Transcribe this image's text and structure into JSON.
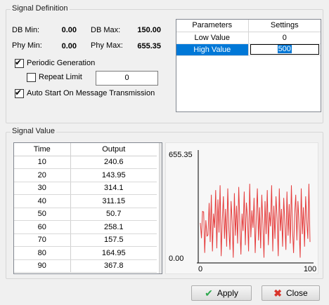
{
  "signal_definition": {
    "title": "Signal Definition",
    "db_min_label": "DB Min:",
    "db_min_value": "0.00",
    "db_max_label": "DB Max:",
    "db_max_value": "150.00",
    "phy_min_label": "Phy Min:",
    "phy_min_value": "0.00",
    "phy_max_label": "Phy Max:",
    "phy_max_value": "655.35",
    "periodic_generation": {
      "label": "Periodic Generation",
      "checked": true
    },
    "repeat_limit": {
      "label": "Repeat Limit",
      "checked": false,
      "value": "0"
    },
    "auto_start": {
      "label": "Auto Start On Message Transmission",
      "checked": true
    },
    "params_table": {
      "headers": [
        "Parameters",
        "Settings"
      ],
      "rows": [
        {
          "param": "Low Value",
          "setting": "0"
        },
        {
          "param": "High Value",
          "setting": "500"
        }
      ]
    }
  },
  "signal_value": {
    "title": "Signal Value",
    "list_headers": [
      "Time",
      "Output"
    ],
    "rows": [
      {
        "time": "10",
        "output": "240.6"
      },
      {
        "time": "20",
        "output": "143.95"
      },
      {
        "time": "30",
        "output": "314.1"
      },
      {
        "time": "40",
        "output": "311.15"
      },
      {
        "time": "50",
        "output": "50.7"
      },
      {
        "time": "60",
        "output": "258.1"
      },
      {
        "time": "70",
        "output": "157.5"
      },
      {
        "time": "80",
        "output": "164.95"
      },
      {
        "time": "90",
        "output": "367.8"
      }
    ]
  },
  "chart_data": {
    "type": "line",
    "y_max_label": "655.35",
    "y_min_label": "0.00",
    "x_tick_labels": [
      "0",
      "100"
    ],
    "xlim": [
      0,
      100
    ],
    "ylim": [
      0,
      655.35
    ],
    "line_color": "#e53b3b",
    "series": [
      {
        "values": [
          240.6,
          143.95,
          314.1,
          311.15,
          50.7,
          258.1,
          157.5,
          164.95,
          367.8,
          120,
          420,
          60,
          300,
          210,
          450,
          80,
          390,
          180,
          480,
          30,
          260,
          410,
          140,
          330,
          90,
          460,
          200,
          70,
          380,
          250,
          20,
          430,
          160,
          350,
          110,
          470,
          230,
          40,
          300,
          190,
          440,
          100,
          370,
          270,
          60,
          490,
          150,
          320,
          210,
          400,
          50,
          280,
          460,
          130,
          340,
          80,
          420,
          240,
          20,
          380,
          170,
          450,
          100,
          310,
          220,
          480,
          60,
          350,
          140,
          410,
          270,
          30,
          460,
          190,
          330,
          90,
          400,
          250,
          70,
          440,
          160,
          360,
          110,
          480,
          210,
          50,
          300,
          420,
          130,
          380,
          230,
          20,
          460,
          170,
          340,
          90,
          410,
          260,
          140,
          490,
          120
        ]
      }
    ]
  },
  "buttons": {
    "apply_label": "Apply",
    "close_label": "Close"
  },
  "colors": {
    "accent_selection": "#0078d7",
    "apply_icon": "#2fa84f",
    "close_icon": "#d9342b"
  }
}
